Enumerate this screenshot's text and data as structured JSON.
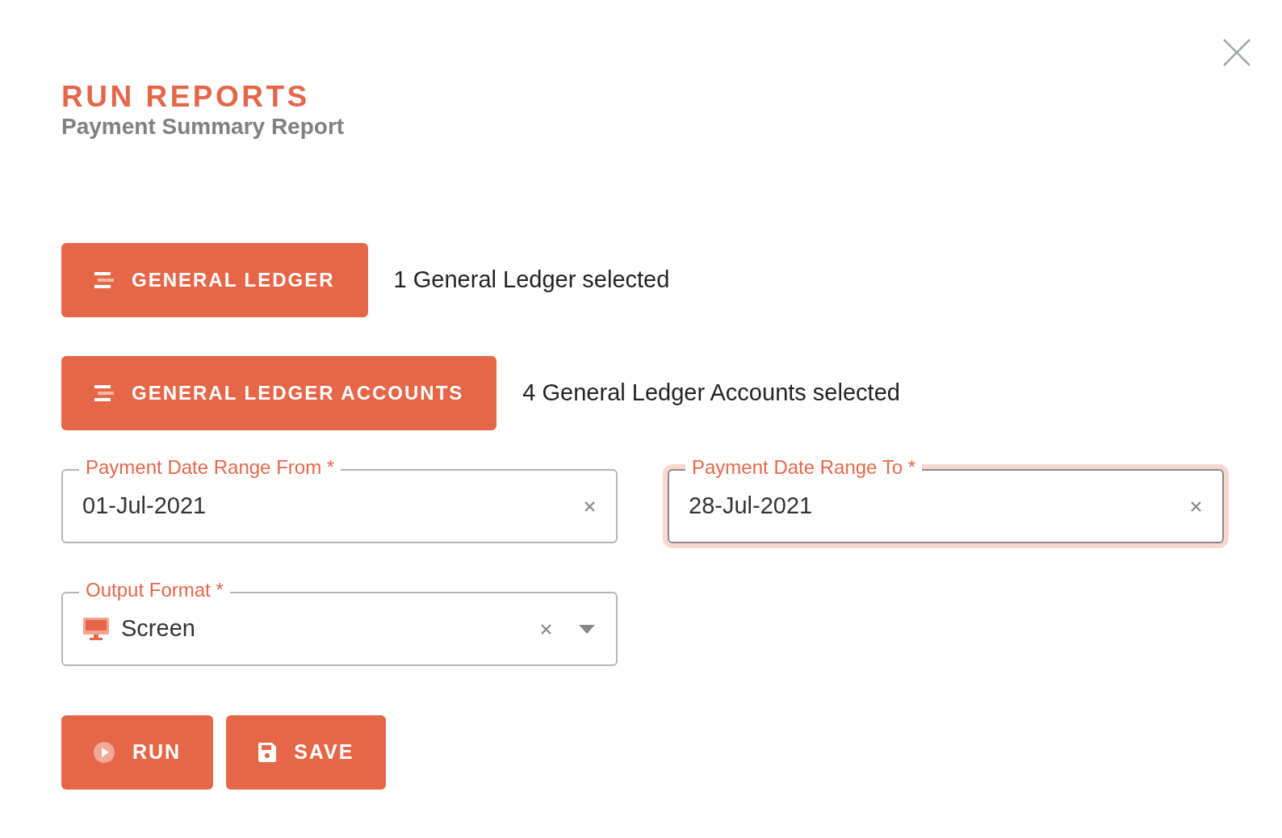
{
  "dialog": {
    "title": "RUN REPORTS",
    "subtitle": "Payment Summary Report"
  },
  "selectors": [
    {
      "label": "GENERAL LEDGER",
      "status": "1 General Ledger selected"
    },
    {
      "label": "GENERAL LEDGER ACCOUNTS",
      "status": "4 General Ledger Accounts selected"
    }
  ],
  "date_fields": [
    {
      "label": "Payment Date Range From *",
      "value": "01-Jul-2021",
      "focused": false
    },
    {
      "label": "Payment Date Range To *",
      "value": "28-Jul-2021",
      "focused": true
    }
  ],
  "output_format": {
    "label": "Output Format *",
    "value": "Screen"
  },
  "actions": [
    {
      "label": "RUN",
      "kind": "run"
    },
    {
      "label": "SAVE",
      "kind": "save"
    }
  ]
}
